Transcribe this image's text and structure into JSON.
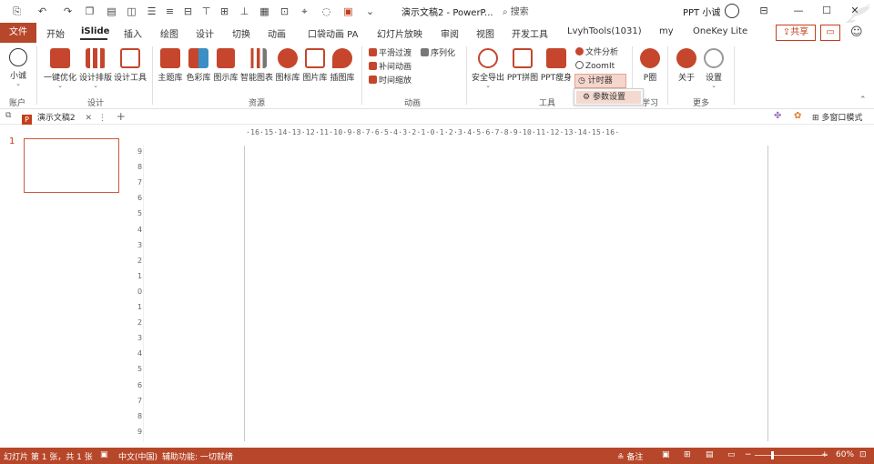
{
  "titlebar": {
    "doc_title": "演示文稿2 - PowerP...",
    "search_placeholder": "搜索",
    "user_name": "PPT 小诚"
  },
  "tabs": [
    {
      "label": "文件"
    },
    {
      "label": "开始"
    },
    {
      "label": "iSlide"
    },
    {
      "label": "插入"
    },
    {
      "label": "绘图"
    },
    {
      "label": "设计"
    },
    {
      "label": "切换"
    },
    {
      "label": "动画"
    },
    {
      "label": "口袋动画 PA"
    },
    {
      "label": "幻灯片放映"
    },
    {
      "label": "审阅"
    },
    {
      "label": "视图"
    },
    {
      "label": "开发工具"
    },
    {
      "label": "LvyhTools(1031)"
    },
    {
      "label": "my"
    },
    {
      "label": "OneKey Lite"
    }
  ],
  "share_label": "共享",
  "ribbon": {
    "account": {
      "label": "小诚",
      "group": "账户"
    },
    "design": {
      "group": "设计",
      "buttons": [
        {
          "label": "一键优化"
        },
        {
          "label": "设计排版"
        },
        {
          "label": "设计工具"
        }
      ]
    },
    "resources": {
      "group": "资源",
      "buttons": [
        {
          "label": "主题库"
        },
        {
          "label": "色彩库"
        },
        {
          "label": "图示库"
        },
        {
          "label": "智能图表"
        },
        {
          "label": "图标库"
        },
        {
          "label": "图片库"
        },
        {
          "label": "插图库"
        }
      ]
    },
    "animation": {
      "group": "动画",
      "items": [
        {
          "label": "平滑过渡"
        },
        {
          "label": "序列化"
        },
        {
          "label": "补间动画"
        },
        {
          "label": "时间缩放"
        }
      ]
    },
    "tools": {
      "group": "工具",
      "buttons": [
        {
          "label": "安全导出"
        },
        {
          "label": "PPT拼图"
        },
        {
          "label": "PPT瘦身"
        }
      ],
      "file_analysis": "文件分析",
      "zoomit": "ZoomIt",
      "timer": "计时器",
      "dropdown_item": "参数设置"
    },
    "learn": {
      "group": "学习",
      "label": "P圈"
    },
    "more": {
      "group": "更多",
      "buttons": [
        {
          "label": "关于"
        },
        {
          "label": "设置"
        }
      ]
    }
  },
  "docbar": {
    "tab_label": "演示文稿2",
    "multi_window": "多窗口模式"
  },
  "workspace": {
    "slide_number": "1",
    "hruler": "·16·15·14·13·12·11·10·9·8·7·6·5·4·3·2·1·0·1·2·3·4·5·6·7·8·9·10·11·12·13·14·15·16·",
    "vruler": [
      "9",
      "8",
      "7",
      "6",
      "5",
      "4",
      "3",
      "2",
      "1",
      "0",
      "1",
      "2",
      "3",
      "4",
      "5",
      "6",
      "7",
      "8",
      "9"
    ]
  },
  "statusbar": {
    "slide_info": "幻灯片 第 1 张，共 1 张",
    "language": "中文(中国)",
    "accessibility": "辅助功能: 一切就绪",
    "notes": "备注",
    "zoom": "60%"
  },
  "colors": {
    "accent": "#b7472a",
    "share": "#c43e1c"
  }
}
